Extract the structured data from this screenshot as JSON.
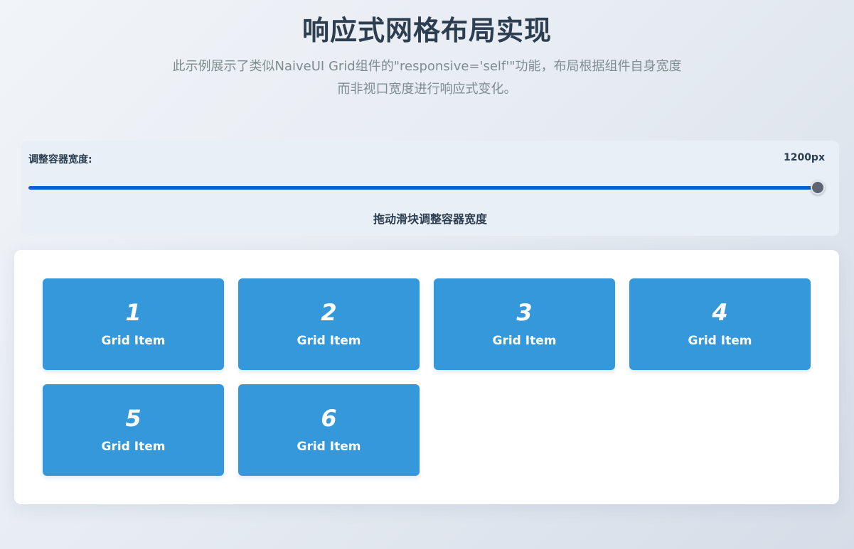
{
  "header": {
    "title": "响应式网格布局实现",
    "subtitle": "此示例展示了类似NaiveUI Grid组件的\"responsive='self'\"功能，布局根据组件自身宽度而非视口宽度进行响应式变化。"
  },
  "control": {
    "label": "调整容器宽度:",
    "value": "1200px",
    "slider_level": 1.0,
    "hint": "拖动滑块调整容器宽度"
  },
  "grid": {
    "items": [
      {
        "number": "1",
        "label": "Grid Item"
      },
      {
        "number": "2",
        "label": "Grid Item"
      },
      {
        "number": "3",
        "label": "Grid Item"
      },
      {
        "number": "4",
        "label": "Grid Item"
      },
      {
        "number": "5",
        "label": "Grid Item"
      },
      {
        "number": "6",
        "label": "Grid Item"
      }
    ]
  },
  "colors": {
    "item_bg": "#3598db",
    "slider_fill": "#0a5fd6",
    "title_text": "#2c3e50",
    "subtitle_text": "#7f8c8d"
  }
}
